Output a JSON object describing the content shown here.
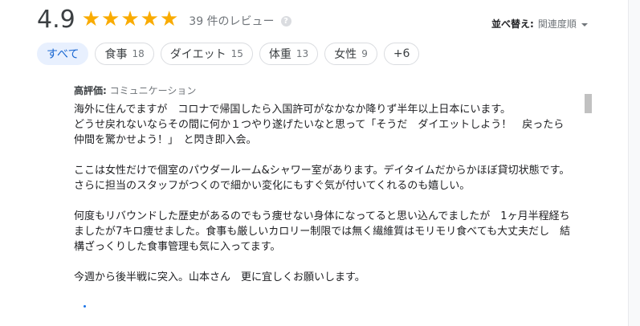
{
  "summary": {
    "rating": "4.9",
    "stars": [
      "★",
      "★",
      "★",
      "★",
      "★"
    ],
    "review_count": "39 件のレビュー",
    "help_symbol": "?"
  },
  "sort": {
    "label": "並べ替え:",
    "value": "関連度順"
  },
  "filters": [
    {
      "label": "すべて",
      "count": "",
      "active": true
    },
    {
      "label": "食事",
      "count": "18",
      "active": false
    },
    {
      "label": "ダイエット",
      "count": "15",
      "active": false
    },
    {
      "label": "体重",
      "count": "13",
      "active": false
    },
    {
      "label": "女性",
      "count": "9",
      "active": false
    },
    {
      "label": "+6",
      "count": "",
      "active": false
    }
  ],
  "review": {
    "label": "高評価:",
    "aspect": "コミュニケーション",
    "paragraphs": [
      "海外に住んでますが　コロナで帰国したら入国許可がなかなか降りず半年以上日本にいます。\nどうせ戻れないならその間に何か１つやり遂げたいなと思って「そうだ　ダイエットしよう！　戻ったら仲間を驚かせよう！」　と閃き即入会。",
      "ここは女性だけで個室のパウダールーム&シャワー室があります。デイタイムだからかほぼ貸切状態です。\nさらに担当のスタッフがつくので細かい変化にもすぐ気が付いてくれるのも嬉しい。",
      "何度もリバウンドした歴史があるのでもう痩せない身体になってると思い込んでましたが　1ヶ月半程経ちましたが7キロ痩せました。食事も厳しいカロリー制限では無く繊維質はモリモリ食べても大丈夫だし　結構ざっくりした食事管理も気に入ってます。",
      "今週から後半戦に突入。山本さん　更に宜しくお願いします。"
    ]
  },
  "colors": {
    "star": "#f9ab00",
    "active_chip_bg": "#e8f0fe",
    "active_chip_text": "#1967d2"
  }
}
